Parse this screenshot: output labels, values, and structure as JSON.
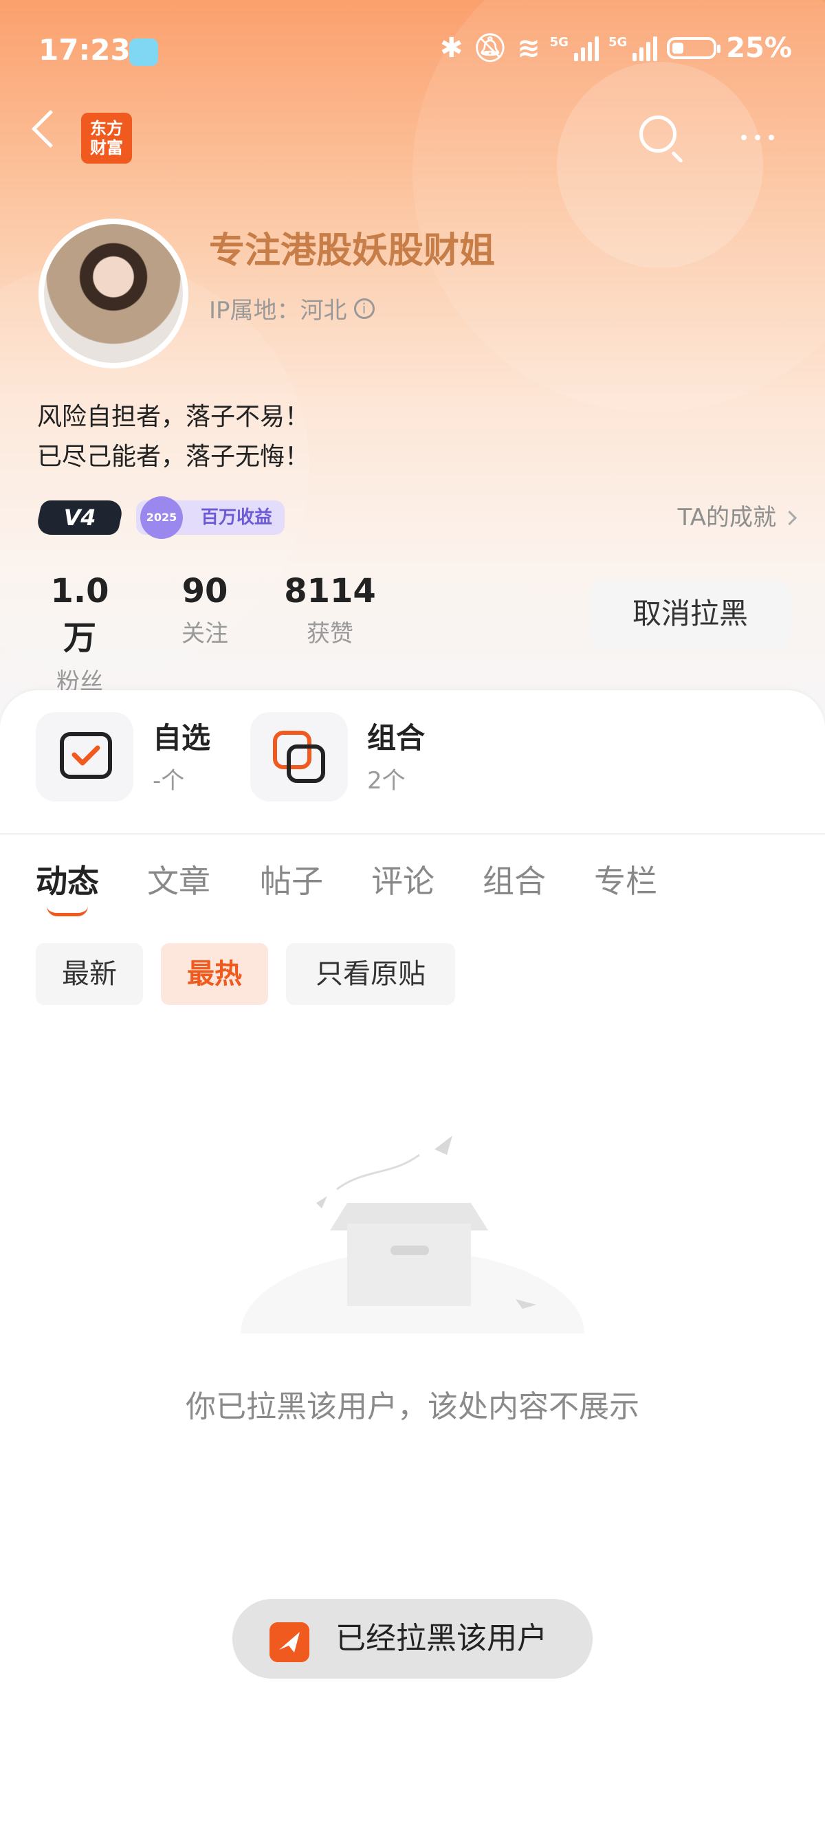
{
  "status_bar": {
    "time": "17:23",
    "battery": "25%",
    "net1": "5G",
    "net2": "5G"
  },
  "nav": {
    "logo_line1": "东方",
    "logo_line2": "财富"
  },
  "profile": {
    "name": "专注港股妖股财姐",
    "ip_label": "IP属地：河北",
    "bio_line1": "风险自担者，落子不易！",
    "bio_line2": "已尽己能者，落子无悔！",
    "level_badge": "V4",
    "medal_year": "2025",
    "medal_label": "百万收益",
    "achievement_link": "TA的成就"
  },
  "stats": [
    {
      "value": "1.0万",
      "label": "粉丝"
    },
    {
      "value": "90",
      "label": "关注"
    },
    {
      "value": "8114",
      "label": "获赞"
    }
  ],
  "unblock_button": "取消拉黑",
  "quick": [
    {
      "title": "自选",
      "sub": "-个"
    },
    {
      "title": "组合",
      "sub": "2个"
    }
  ],
  "tabs": [
    "动态",
    "文章",
    "帖子",
    "评论",
    "组合",
    "专栏"
  ],
  "filters": [
    "最新",
    "最热",
    "只看原贴"
  ],
  "empty_message": "你已拉黑该用户，该处内容不展示",
  "toast": "已经拉黑该用户",
  "colors": {
    "brand": "#f05a1e",
    "name": "#c77d47"
  }
}
